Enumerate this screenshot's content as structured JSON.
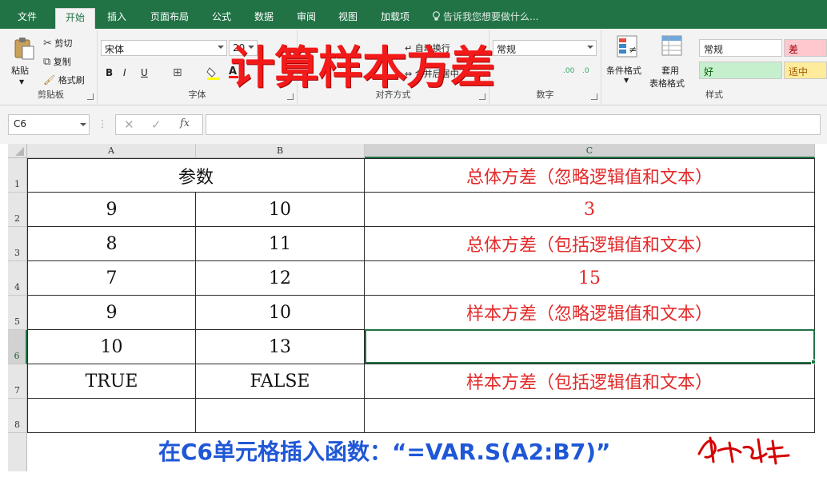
{
  "menu": {
    "tabs": [
      "文件",
      "开始",
      "插入",
      "页面布局",
      "公式",
      "数据",
      "审阅",
      "视图",
      "加载项"
    ],
    "tellme": "告诉我您想要做什么..."
  },
  "ribbon": {
    "clipboard": {
      "paste": "粘贴",
      "cut": "剪切",
      "copy": "复制",
      "format_painter": "格式刷",
      "label": "剪贴板"
    },
    "font": {
      "name": "宋体",
      "size": "20",
      "bold": "B",
      "italic": "I",
      "underline": "U",
      "label": "字体"
    },
    "alignment": {
      "label": "对齐方式",
      "wrap": "自动换行",
      "merge": "合并后居中"
    },
    "number": {
      "format": "常规",
      "label": "数字",
      "inc": ".00",
      "dec": ".0"
    },
    "styles_group": {
      "conditional": "条件格式",
      "table_line1": "套用",
      "table_line2": "表格格式",
      "label": "样式",
      "normal": "常规",
      "bad": "差",
      "good": "好",
      "neutral": "适中"
    }
  },
  "formula_bar": {
    "name_box": "C6",
    "value": ""
  },
  "grid": {
    "columns": [
      "A",
      "B",
      "C"
    ],
    "rows": [
      "1",
      "2",
      "3",
      "4",
      "5",
      "6",
      "7",
      "8"
    ],
    "cells": {
      "r1": {
        "ab": "参数",
        "c": "总体方差（忽略逻辑值和文本）"
      },
      "r2": {
        "a": "9",
        "b": "10",
        "c": "3"
      },
      "r3": {
        "a": "8",
        "b": "11",
        "c": "总体方差（包括逻辑值和文本）"
      },
      "r4": {
        "a": "7",
        "b": "12",
        "c": "15"
      },
      "r5": {
        "a": "9",
        "b": "10",
        "c": "样本方差（忽略逻辑值和文本）"
      },
      "r6": {
        "a": "10",
        "b": "13",
        "c": ""
      },
      "r7": {
        "a": "TRUE",
        "b": "FALSE",
        "c": "样本方差（包括逻辑值和文本）"
      },
      "r8": {
        "a": "",
        "b": "",
        "c": ""
      }
    }
  },
  "overlay": {
    "title": "计算样本方差",
    "caption": "在C6单元格插入函数：“=VAR.S(A2:B7)”"
  },
  "colors": {
    "excel_green": "#217346",
    "title_red": "#f31a1a",
    "text_red": "#e32a2a",
    "caption_blue": "#1f57d6",
    "good_bg": "#c6efce",
    "bad_bg": "#ffc7ce",
    "neutral_bg": "#ffeb9c"
  }
}
